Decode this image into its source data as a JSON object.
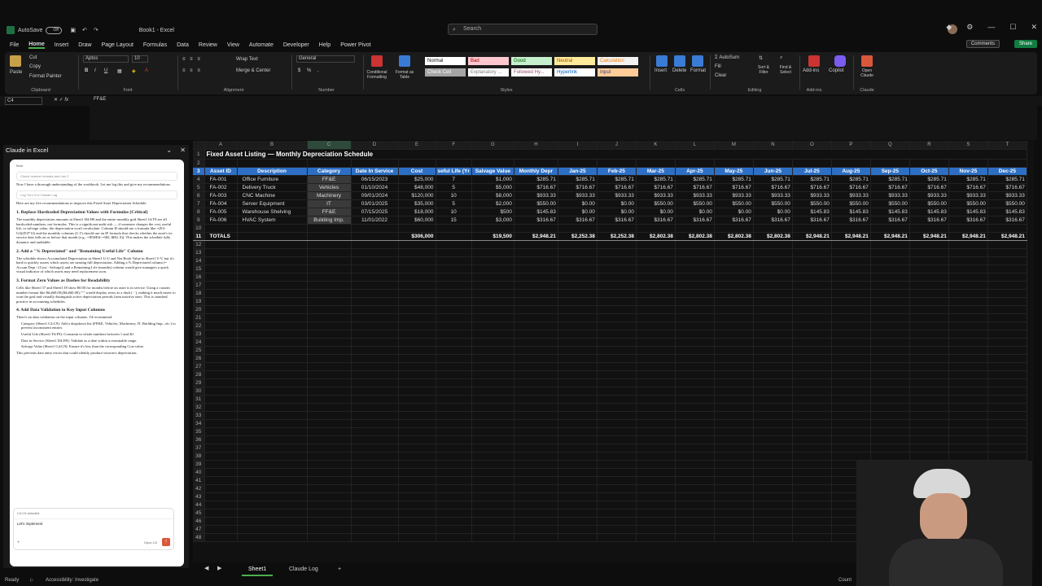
{
  "titlebar": {
    "autosave": "AutoSave",
    "autosave_state": "Off",
    "filename": "Book1 - Excel",
    "search_placeholder": "Search"
  },
  "menu": {
    "items": [
      "File",
      "Home",
      "Insert",
      "Draw",
      "Page Layout",
      "Formulas",
      "Data",
      "Review",
      "View",
      "Automate",
      "Developer",
      "Help",
      "Power Pivot"
    ],
    "comments": "Comments",
    "share": "Share"
  },
  "ribbon": {
    "clipboard": {
      "paste": "Paste",
      "cut": "Cut",
      "copy": "Copy",
      "format_painter": "Format Painter",
      "label": "Clipboard"
    },
    "font": {
      "name": "Aptos",
      "size": "10",
      "label": "Font"
    },
    "alignment": {
      "wrap": "Wrap Text",
      "merge": "Merge & Center",
      "label": "Alignment"
    },
    "number": {
      "format": "General",
      "label": "Number"
    },
    "styles": {
      "conditional": "Conditional Formatting",
      "format_table": "Format as Table",
      "cell_styles": "Cell Styles",
      "label": "Styles",
      "items": [
        {
          "name": "Normal",
          "bg": "#ffffff",
          "fg": "#111111"
        },
        {
          "name": "Bad",
          "bg": "#ffc7ce",
          "fg": "#9c0006"
        },
        {
          "name": "Good",
          "bg": "#c6efce",
          "fg": "#006100"
        },
        {
          "name": "Neutral",
          "bg": "#ffeb9c",
          "fg": "#9c5700"
        },
        {
          "name": "Calculation",
          "bg": "#f2f2f2",
          "fg": "#fa7d00"
        },
        {
          "name": "Check Cell",
          "bg": "#a5a5a5",
          "fg": "#ffffff"
        },
        {
          "name": "Explanatory ...",
          "bg": "#ffffff",
          "fg": "#7f7f7f"
        },
        {
          "name": "Followed Hy...",
          "bg": "#ffffff",
          "fg": "#954f72"
        },
        {
          "name": "Hyperlink",
          "bg": "#ffffff",
          "fg": "#0563c1"
        },
        {
          "name": "Input",
          "bg": "#ffcc99",
          "fg": "#3f3f76"
        }
      ]
    },
    "cells": {
      "insert": "Insert",
      "delete": "Delete",
      "format": "Format",
      "label": "Cells"
    },
    "editing": {
      "autosum": "AutoSum",
      "fill": "Fill",
      "clear": "Clear",
      "sort": "Sort & Filter",
      "find": "Find & Select",
      "label": "Editing"
    },
    "addins": {
      "addins": "Add-ins",
      "label": "Add-ins"
    },
    "copilot": {
      "label": "Copilot"
    },
    "claude": {
      "open": "Open Claude",
      "label": "Claude"
    }
  },
  "formula_bar": {
    "name_box": "C4",
    "fx": "fx",
    "value": "FF&E"
  },
  "panel": {
    "title": "Claude in Excel",
    "beta": "Beta",
    "tool1": "Check number formats and row 2",
    "intro": "Now I have a thorough understanding of the workbook. Let me log this and give my recommendations.",
    "tool2": "Log Turn 3 to Claude Log",
    "lead": "Here are my five recommendations to improve this Fixed Asset Depreciation Schedule:",
    "recs": [
      {
        "title": "1. Replace Hardcoded Depreciation Values with Formulas (Critical)",
        "body": "The monthly depreciation amounts in Sheet1 H4:H9 and the entire monthly grid Sheet1 I4:T9 are all hardcoded numbers, not formulas. This is a significant audit risk — if someone changes the cost, useful life, or salvage value, the depreciation won't recalculate. Column H should use a formula like =(E4-G4)/(F4*12) and the monthly columns (I–T) should use an IF formula that checks whether the asset's in-service date falls on or before that month (e.g., =IF($D4<=I$3, $H4, 0)). This makes the schedule fully dynamic and auditable."
      },
      {
        "title": "2. Add a \"% Depreciated\" and \"Remaining Useful Life\" Column",
        "body": "The schedule shows Accumulated Depreciation in Sheet1 U:U and Net Book Value in Sheet1 V:V, but it's hard to quickly assess which assets are nearing full depreciation. Adding a % Depreciated column (= Accum Depr / (Cost - Salvage)) and a Remaining Life (months) column would give managers a quick visual indicator of which assets may need replacement soon."
      },
      {
        "title": "3. Format Zero Values as Dashes for Readability",
        "body": "Cells like Sheet1 I7 and Sheet1 J8 show $0.00 for months before an asset is in service. Using a custom number format like $#,##0.00;($#,##0.00);\"-\" would display zeros as a dash ( - ), making it much easier to scan the grid and visually distinguish active depreciation periods from inactive ones. This is standard practice in accounting schedules."
      },
      {
        "title": "4. Add Data Validation to Key Input Columns",
        "body": "There's no data validation on the input columns. I'd recommend:"
      }
    ],
    "bullets": [
      "Category (Sheet1 C4:C9): Add a dropdown list (FF&E, Vehicles, Machinery, IT, Building Imp., etc.) to prevent inconsistent entries.",
      "Useful Life (Sheet1 F4:F9): Constrain to whole numbers between 1 and 40.",
      "Date in Service (Sheet1 D4:D9): Validate as a date within a reasonable range.",
      "Salvage Value (Sheet1 G4:G9): Ensure it's less than the corresponding Cost value."
    ],
    "outro": "This prevents data entry errors that could silently produce incorrect depreciation.",
    "selection_chip": "C4:C9 selected",
    "composer_text": "Let's implement",
    "model": "Opus 4.6"
  },
  "sheet": {
    "col_letters": [
      "A",
      "B",
      "C",
      "D",
      "E",
      "F",
      "G",
      "H",
      "I",
      "J",
      "K",
      "L",
      "M",
      "N",
      "O",
      "P",
      "Q",
      "R",
      "S",
      "T"
    ],
    "title": "Fixed Asset Listing — Monthly Depreciation Schedule",
    "headers": [
      "Asset ID",
      "Description",
      "Category",
      "Date In Service",
      "Cost",
      "seful Life (Yr",
      "Salvage Value",
      "Monthly Depr",
      "Jan-25",
      "Feb-25",
      "Mar-25",
      "Apr-25",
      "May-25",
      "Jun-25",
      "Jul-25",
      "Aug-25",
      "Sep-25",
      "Oct-25",
      "Nov-25",
      "Dec-25"
    ],
    "rows": [
      [
        "FA-001",
        "Office Furniture",
        "FF&E",
        "06/15/2023",
        "$25,000",
        "7",
        "$1,000",
        "$285.71",
        "$285.71",
        "$285.71",
        "$285.71",
        "$285.71",
        "$285.71",
        "$285.71",
        "$285.71",
        "$285.71",
        "$285.71",
        "$285.71",
        "$285.71",
        "$285.71"
      ],
      [
        "FA-002",
        "Delivery Truck",
        "Vehicles",
        "01/10/2024",
        "$48,000",
        "5",
        "$5,000",
        "$716.67",
        "$716.67",
        "$716.67",
        "$716.67",
        "$716.67",
        "$716.67",
        "$716.67",
        "$716.67",
        "$716.67",
        "$716.67",
        "$716.67",
        "$716.67",
        "$716.67"
      ],
      [
        "FA-003",
        "CNC Machine",
        "Machinery",
        "09/01/2024",
        "$120,000",
        "10",
        "$8,000",
        "$933.33",
        "$933.33",
        "$933.33",
        "$933.33",
        "$933.33",
        "$933.33",
        "$933.33",
        "$933.33",
        "$933.33",
        "$933.33",
        "$933.33",
        "$933.33",
        "$933.33"
      ],
      [
        "FA-004",
        "Server Equipment",
        "IT",
        "03/01/2025",
        "$35,000",
        "5",
        "$2,000",
        "$550.00",
        "$0.00",
        "$0.00",
        "$550.00",
        "$550.00",
        "$550.00",
        "$550.00",
        "$550.00",
        "$550.00",
        "$550.00",
        "$550.00",
        "$550.00",
        "$550.00"
      ],
      [
        "FA-005",
        "Warehouse Shelving",
        "FF&E",
        "07/15/2025",
        "$18,000",
        "10",
        "$500",
        "$145.83",
        "$0.00",
        "$0.00",
        "$0.00",
        "$0.00",
        "$0.00",
        "$0.00",
        "$145.83",
        "$145.83",
        "$145.83",
        "$145.83",
        "$145.83",
        "$145.83"
      ],
      [
        "FA-006",
        "HVAC System",
        "Building Imp.",
        "11/01/2022",
        "$60,000",
        "15",
        "$3,000",
        "$316.67",
        "$316.67",
        "$316.67",
        "$316.67",
        "$316.67",
        "$316.67",
        "$316.67",
        "$316.67",
        "$316.67",
        "$316.67",
        "$316.67",
        "$316.67",
        "$316.67"
      ]
    ],
    "totals": [
      "TOTALS",
      "",
      "",
      "",
      "$306,000",
      "",
      "$19,500",
      "$2,948.21",
      "$2,252.38",
      "$2,252.38",
      "$2,802.38",
      "$2,802.38",
      "$2,802.38",
      "$2,802.38",
      "$2,948.21",
      "$2,948.21",
      "$2,948.21",
      "$2,948.21",
      "$2,948.21",
      "$2,948.21"
    ]
  },
  "tabs": [
    "Sheet1",
    "Claude Log"
  ],
  "status": {
    "ready": "Ready",
    "accessibility": "Accessibility: Investigate",
    "count": "Count"
  }
}
